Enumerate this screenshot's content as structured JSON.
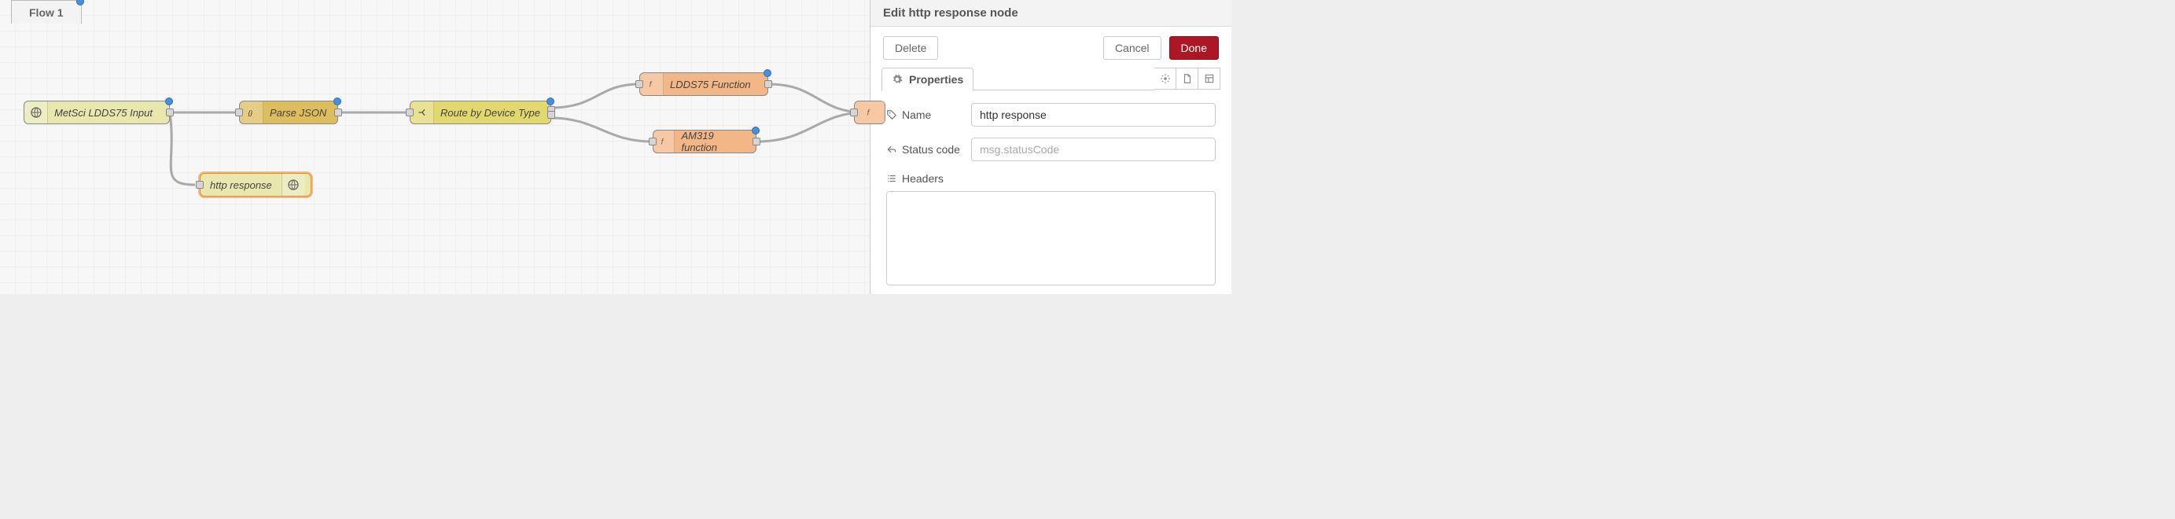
{
  "flow": {
    "tab_label": "Flow 1",
    "tab_changed": true,
    "nodes": {
      "input": {
        "label": "MetSci LDDS75 Input"
      },
      "json": {
        "label": "Parse JSON"
      },
      "switch": {
        "label": "Route by Device Type"
      },
      "fn1": {
        "label": "LDDS75 Function"
      },
      "fn2": {
        "label": "AM319 function"
      },
      "resp": {
        "label": "http response"
      }
    }
  },
  "sidebar": {
    "title": "Edit http response node",
    "delete_label": "Delete",
    "cancel_label": "Cancel",
    "done_label": "Done",
    "properties_tab": "Properties",
    "name_label": "Name",
    "name_value": "http response",
    "status_label": "Status code",
    "status_placeholder": "msg.statusCode",
    "status_value": "",
    "headers_label": "Headers"
  }
}
